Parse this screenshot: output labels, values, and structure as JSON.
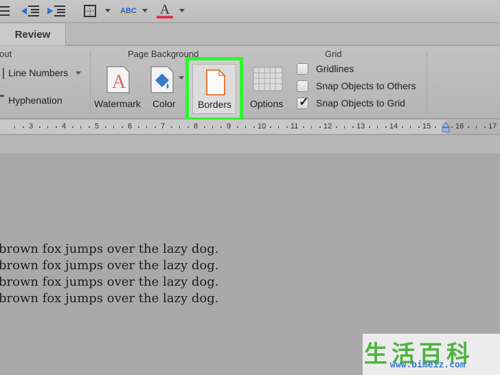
{
  "ribbon_tab": "Review",
  "groups": {
    "layout_partial": "out",
    "page_background": "Page Background",
    "grid": "Grid"
  },
  "layout": {
    "line_numbers": "Line Numbers",
    "hyphenation": "Hyphenation"
  },
  "page_background": {
    "watermark": "Watermark",
    "color": "Color",
    "borders": "Borders"
  },
  "options": "Options",
  "grid": {
    "gridlines": {
      "label": "Gridlines",
      "checked": false
    },
    "snap_objects_to_others": {
      "label": "Snap Objects to Others",
      "checked": false
    },
    "snap_objects_to_grid": {
      "label": "Snap Objects to Grid",
      "checked": true
    }
  },
  "toolbar": {
    "spell_label": "ABC",
    "font_color_label": "A"
  },
  "ruler": [
    "3",
    "4",
    "5",
    "6",
    "7",
    "8",
    "9",
    "10",
    "11",
    "12",
    "13",
    "14",
    "15",
    "16",
    "17"
  ],
  "document": {
    "lines": [
      "brown fox jumps over the lazy dog.",
      "brown fox jumps over the lazy dog.",
      "brown fox jumps over the lazy dog.",
      "brown fox jumps over the lazy dog."
    ]
  },
  "watermark_logo": {
    "chars": [
      "生",
      "活",
      "百",
      "科"
    ],
    "url": "www.bimeiz.com"
  },
  "colors": {
    "highlight": "#2ef52e",
    "window_bg": "#a9a9a9"
  }
}
